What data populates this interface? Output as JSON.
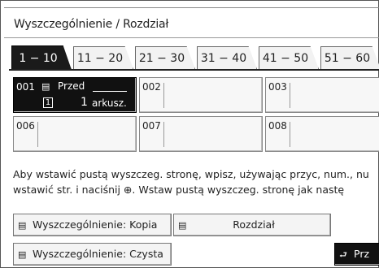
{
  "title": "Wyszczególnienie / Rozdział",
  "tabs": [
    {
      "label": "1 − 10"
    },
    {
      "label": "11 − 20"
    },
    {
      "label": "21 − 30"
    },
    {
      "label": "31 − 40"
    },
    {
      "label": "41 − 50"
    },
    {
      "label": "51 − 60"
    }
  ],
  "cells": [
    {
      "num": "001",
      "selected": true,
      "label": "Przed",
      "box": "1",
      "count": "1",
      "unit": "arkusz."
    },
    {
      "num": "002"
    },
    {
      "num": "003"
    },
    {
      "num": "006"
    },
    {
      "num": "007"
    },
    {
      "num": "008"
    }
  ],
  "instructions": {
    "line1": "Aby wstawić pustą wyszczeg. stronę, wpisz, używając przyc, num., nu",
    "line2": "wstawić str. i naciśnij ⊕. Wstaw pustą wyszczeg. stronę jak nastę"
  },
  "buttons": {
    "copy": "Wyszczególnienie: Kopia",
    "chapter": "Rozdział",
    "blank": "Wyszczególnienie: Czysta",
    "next": "Prz"
  },
  "icons": {
    "copy": "document-icon",
    "chapter": "document-icon",
    "blank": "document-icon",
    "next": "enter-arrow-icon"
  }
}
